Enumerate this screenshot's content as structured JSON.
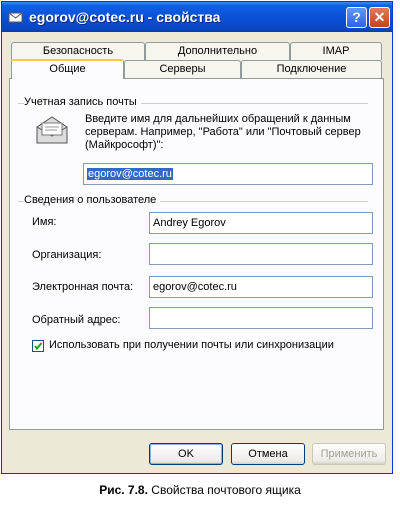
{
  "window": {
    "title": "egorov@cotec.ru - свойства",
    "help_glyph": "?",
    "close_glyph": "✕"
  },
  "tabs": {
    "row1": [
      "Безопасность",
      "Дополнительно",
      "IMAP"
    ],
    "row2": [
      "Общие",
      "Серверы",
      "Подключение"
    ],
    "active": "Общие"
  },
  "account": {
    "group_label": "Учетная запись почты",
    "description": "Введите имя для дальнейших обращений к данным серверам. Например, \"Работа\" или \"Почтовый сервер (Майкрософт)\":",
    "name_value": "egorov@cotec.ru"
  },
  "user": {
    "group_label": "Сведения о пользователе",
    "name_label": "Имя:",
    "name_value": "Andrey Egorov",
    "org_label": "Организация:",
    "org_value": "",
    "email_label": "Электронная почта:",
    "email_value": "egorov@cotec.ru",
    "reply_label": "Обратный адрес:",
    "reply_value": ""
  },
  "checkbox": {
    "label": "Использовать при получении почты или синхронизации",
    "checked": true
  },
  "buttons": {
    "ok": "OK",
    "cancel": "Отмена",
    "apply": "Применить"
  },
  "caption": {
    "number": "Рис. 7.8.",
    "text": "Свойства почтового ящика"
  }
}
